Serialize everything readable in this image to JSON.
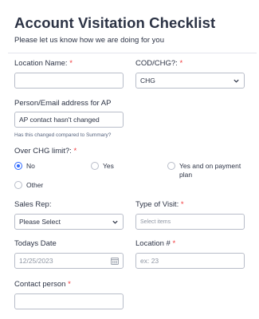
{
  "form": {
    "title": "Account Visitation Checklist",
    "subtitle": "Please let us know how we are doing for you"
  },
  "fields": {
    "location_name": {
      "label": "Location Name:",
      "required": "*",
      "value": ""
    },
    "cod_chg": {
      "label": "COD/CHG?:",
      "required": "*",
      "selected": "CHG"
    },
    "ap_contact": {
      "label": "Person/Email address for AP",
      "value": "AP contact hasn't changed",
      "sublabel": "Has this changed compared to Summary?"
    },
    "over_chg_limit": {
      "label": "Over CHG limit?:",
      "required": "*",
      "options": [
        "No",
        "Yes",
        "Yes and on payment plan",
        "Other"
      ],
      "selected": "No"
    },
    "sales_rep": {
      "label": "Sales Rep:",
      "selected": "Please Select"
    },
    "type_of_visit": {
      "label": "Type of Visit:",
      "required": "*",
      "placeholder": "Select items"
    },
    "todays_date": {
      "label": "Todays Date",
      "placeholder": "12/25/2023"
    },
    "location_number": {
      "label": "Location #",
      "required": "*",
      "placeholder": "ex: 23"
    },
    "contact_person": {
      "label": "Contact person",
      "required": "*",
      "value": ""
    }
  },
  "icons": {
    "dropdown": "chevron-down-icon",
    "calendar": "calendar-icon"
  },
  "colors": {
    "accent": "#2e69ff",
    "required": "#f23a3c",
    "text": "#2c3345"
  }
}
